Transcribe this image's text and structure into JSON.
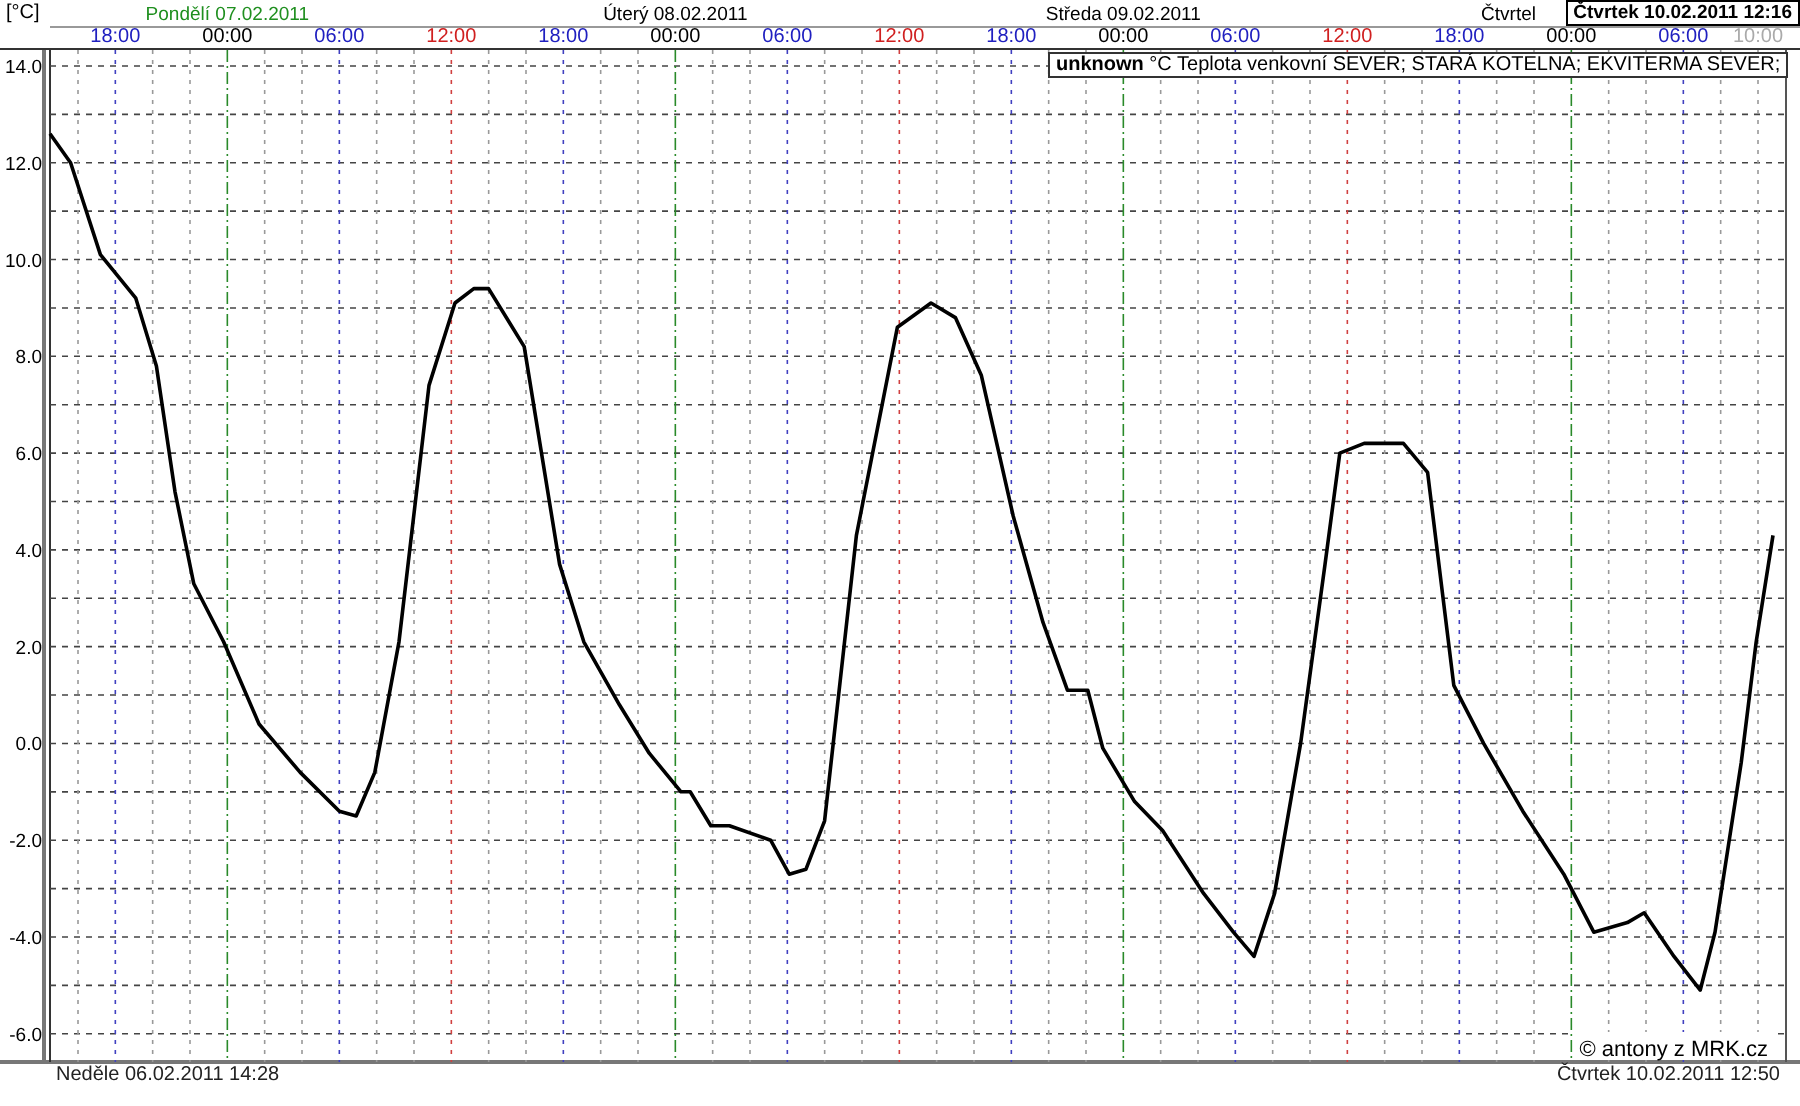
{
  "header": {
    "unit": "[°C]",
    "days": [
      {
        "label": "Pondělí 07.02.2011",
        "color": "#1f8f1f"
      },
      {
        "label": "Úterý 08.02.2011",
        "color": "#000000"
      },
      {
        "label": "Středa 09.02.2011",
        "color": "#000000"
      },
      {
        "label": "Čtvrtel",
        "color": "#000000"
      }
    ],
    "current": "Čtvrtek 10.02.2011 12:16"
  },
  "legend": {
    "value": "unknown",
    "unit": "°C"
  },
  "chart_data": {
    "type": "line",
    "grid": true,
    "ylim": [
      -6.5,
      14.33
    ],
    "xlim": [
      "2011-02-06T14:30",
      "2011-02-10T11:30"
    ],
    "yticks": [
      {
        "value": 14,
        "label": "14.0"
      },
      {
        "value": 12,
        "label": "12.0"
      },
      {
        "value": 10,
        "label": "10.0"
      },
      {
        "value": 8,
        "label": "8.0"
      },
      {
        "value": 6,
        "label": "6.0"
      },
      {
        "value": 4,
        "label": "4.0"
      },
      {
        "value": 2,
        "label": "2.0"
      },
      {
        "value": 0,
        "label": "0.0"
      },
      {
        "value": -2,
        "label": "-2.0"
      },
      {
        "value": -4,
        "label": "-4.0"
      },
      {
        "value": -6,
        "label": "-6.0"
      }
    ],
    "xticks": [
      {
        "value": "2011-02-06T18:00",
        "label": "18:00"
      },
      {
        "value": "2011-02-07T00:00",
        "label": "00:00"
      },
      {
        "value": "2011-02-07T06:00",
        "label": "06:00"
      },
      {
        "value": "2011-02-07T12:00",
        "label": "12:00"
      },
      {
        "value": "2011-02-07T18:00",
        "label": "18:00"
      },
      {
        "value": "2011-02-08T00:00",
        "label": "00:00"
      },
      {
        "value": "2011-02-08T06:00",
        "label": "06:00"
      },
      {
        "value": "2011-02-08T12:00",
        "label": "12:00"
      },
      {
        "value": "2011-02-08T18:00",
        "label": "18:00"
      },
      {
        "value": "2011-02-09T00:00",
        "label": "00:00"
      },
      {
        "value": "2011-02-09T06:00",
        "label": "06:00"
      },
      {
        "value": "2011-02-09T12:00",
        "label": "12:00"
      },
      {
        "value": "2011-02-09T18:00",
        "label": "18:00"
      },
      {
        "value": "2011-02-10T00:00",
        "label": "00:00"
      },
      {
        "value": "2011-02-10T06:00",
        "label": "06:00"
      },
      {
        "value": "2011-02-10T10:00",
        "label": "10:00"
      }
    ],
    "x": [
      "2011-02-06T14:30",
      "2011-02-06T15:36",
      "2011-02-06T17:12",
      "2011-02-06T19:06",
      "2011-02-06T20:12",
      "2011-02-06T21:12",
      "2011-02-06T22:12",
      "2011-02-06T23:48",
      "2011-02-07T01:42",
      "2011-02-07T03:54",
      "2011-02-07T06:00",
      "2011-02-07T06:54",
      "2011-02-07T07:54",
      "2011-02-07T09:12",
      "2011-02-07T10:48",
      "2011-02-07T12:12",
      "2011-02-07T13:12",
      "2011-02-07T14:00",
      "2011-02-07T15:54",
      "2011-02-07T17:48",
      "2011-02-07T19:06",
      "2011-02-07T21:00",
      "2011-02-07T22:36",
      "2011-02-08T00:18",
      "2011-02-08T00:48",
      "2011-02-08T01:54",
      "2011-02-08T02:54",
      "2011-02-08T05:06",
      "2011-02-08T06:06",
      "2011-02-08T07:00",
      "2011-02-08T08:00",
      "2011-02-08T09:42",
      "2011-02-08T11:54",
      "2011-02-08T13:42",
      "2011-02-08T15:00",
      "2011-02-08T16:24",
      "2011-02-08T18:06",
      "2011-02-08T19:42",
      "2011-02-08T21:00",
      "2011-02-08T22:06",
      "2011-02-08T22:54",
      "2011-02-09T00:36",
      "2011-02-09T02:06",
      "2011-02-09T04:18",
      "2011-02-09T05:54",
      "2011-02-09T07:00",
      "2011-02-09T08:06",
      "2011-02-09T09:30",
      "2011-02-09T10:48",
      "2011-02-09T11:36",
      "2011-02-09T12:54",
      "2011-02-09T15:00",
      "2011-02-09T16:18",
      "2011-02-09T17:42",
      "2011-02-09T19:18",
      "2011-02-09T21:24",
      "2011-02-09T23:36",
      "2011-02-10T01:12",
      "2011-02-10T03:00",
      "2011-02-10T03:54",
      "2011-02-10T05:30",
      "2011-02-10T06:54",
      "2011-02-10T07:42",
      "2011-02-10T09:06",
      "2011-02-10T09:54",
      "2011-02-10T10:48"
    ],
    "series": [
      {
        "name": "Teplota venkovní SEVER; STARÁ KOTELNA; EKVITERMA SEVER;",
        "color": "#000000",
        "values": [
          12.6,
          12.0,
          10.1,
          9.2,
          7.8,
          5.2,
          3.3,
          2.1,
          0.4,
          -0.6,
          -1.4,
          -1.5,
          -0.6,
          2.1,
          7.4,
          9.1,
          9.4,
          9.4,
          8.2,
          3.7,
          2.1,
          0.8,
          -0.2,
          -1.0,
          -1.0,
          -1.7,
          -1.7,
          -2.0,
          -2.7,
          -2.6,
          -1.6,
          4.3,
          8.6,
          9.1,
          8.8,
          7.6,
          4.7,
          2.5,
          1.1,
          1.1,
          -0.1,
          -1.2,
          -1.8,
          -3.1,
          -3.9,
          -4.4,
          -3.1,
          0.0,
          3.7,
          6.0,
          6.2,
          6.2,
          5.6,
          1.2,
          0.0,
          -1.4,
          -2.7,
          -3.9,
          -3.7,
          -3.5,
          -4.4,
          -5.1,
          -3.9,
          -0.4,
          2.1,
          4.3
        ]
      }
    ]
  },
  "copyright": "© antony z MRK.cz",
  "footer": {
    "start": "Neděle 06.02.2011 14:28",
    "end": "Čtvrtek 10.02.2011 12:50"
  }
}
